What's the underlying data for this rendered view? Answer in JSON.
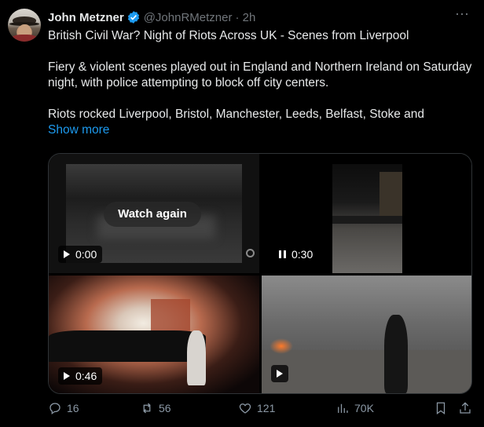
{
  "tweet": {
    "author_name": "John Metzner",
    "handle": "@JohnRMetzner",
    "time": "· 2h",
    "more_icon": "⋯",
    "paragraphs": [
      "British Civil War? Night of Riots Across UK - Scenes from Liverpool",
      "Fiery & violent scenes played out in England and Northern Ireland on Saturday night, with police attempting to block off city centers.",
      "Riots rocked Liverpool, Bristol, Manchester, Leeds, Belfast, Stoke and"
    ],
    "show_more": "Show more"
  },
  "media": {
    "videos": [
      {
        "overlay": "Watch again",
        "timestamp": "0:00",
        "control": "play-icon"
      },
      {
        "timestamp": "0:30",
        "control": "pause-icon"
      },
      {
        "timestamp": "0:46",
        "control": "play-icon"
      },
      {
        "timestamp": "",
        "control": "play-icon"
      }
    ]
  },
  "actions": {
    "replies": "16",
    "reposts": "56",
    "likes": "121",
    "views": "70K"
  },
  "colors": {
    "background": "#000000",
    "text": "#e7e9ea",
    "muted": "#71767b",
    "link": "#1d9bf0",
    "verified": "#1d9bf0"
  }
}
